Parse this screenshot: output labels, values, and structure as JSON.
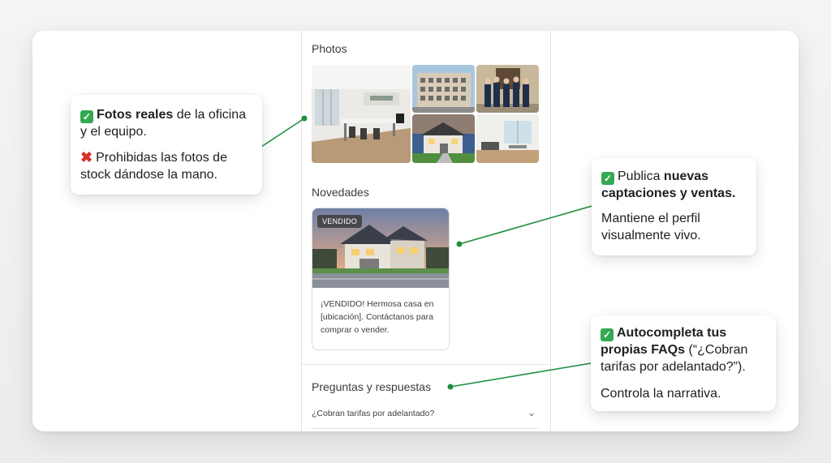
{
  "panel": {
    "photos_title": "Photos",
    "news_title": "Novedades",
    "post": {
      "badge": "VENDIDO",
      "text": "¡VENDIDO! Hermosa casa en [ubicación]. Contáctanos para comprar o vender."
    },
    "qa_title": "Preguntas y respuestas",
    "faq_item": "¿Cobran tarifas por adelantado?",
    "chevron_icon": "chevron-down-icon"
  },
  "callouts": {
    "photos": {
      "line1_bold": "Fotos reales",
      "line1_rest": " de la oficina y el equipo.",
      "line2": "Prohibidas las fotos de stock dándose la mano."
    },
    "news": {
      "line1_plain": "Publica ",
      "line1_bold": "nuevas captaciones y ventas.",
      "line2": "Mantiene el perfil visualmente vivo."
    },
    "faq": {
      "line1_bold": "Autocompleta tus propias FAQs",
      "line1_rest": " (“¿Cobran tarifas por adelantado?”).",
      "line2": "Controla la narrativa."
    }
  },
  "colors": {
    "accent_green": "#1e8e3e",
    "check_green": "#34a853",
    "cross_red": "#d93025"
  },
  "icons": [
    "check-icon",
    "cross-icon",
    "chevron-down-icon"
  ]
}
